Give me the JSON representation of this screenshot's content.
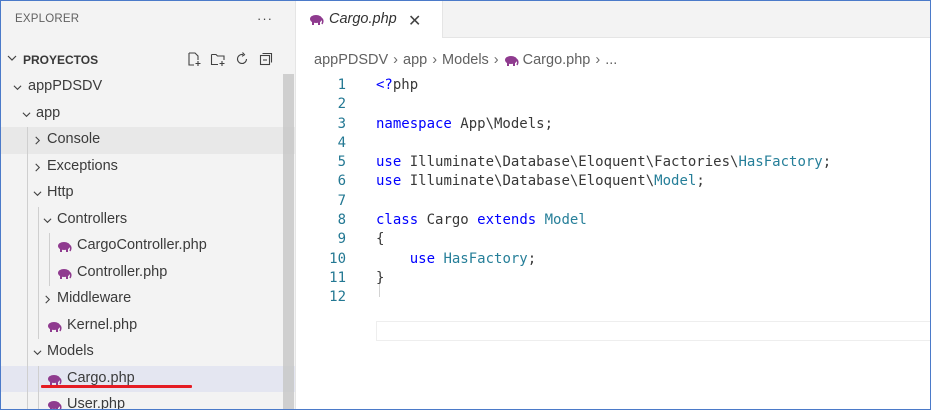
{
  "sidebar": {
    "header": "EXPLORER",
    "more": "···",
    "section": "PROYECTOS",
    "tools": [
      "new-file-icon",
      "new-folder-icon",
      "refresh-icon",
      "collapse-all-icon"
    ],
    "tree": [
      {
        "label": "appPDSDV",
        "type": "folder",
        "open": true,
        "depth": 0
      },
      {
        "label": "app",
        "type": "folder",
        "open": true,
        "depth": 1
      },
      {
        "label": "Console",
        "type": "folder",
        "open": false,
        "depth": 2
      },
      {
        "label": "Exceptions",
        "type": "folder",
        "open": false,
        "depth": 2
      },
      {
        "label": "Http",
        "type": "folder",
        "open": true,
        "depth": 2
      },
      {
        "label": "Controllers",
        "type": "folder",
        "open": true,
        "depth": 3
      },
      {
        "label": "CargoController.php",
        "type": "php",
        "depth": 4
      },
      {
        "label": "Controller.php",
        "type": "php",
        "depth": 4
      },
      {
        "label": "Middleware",
        "type": "folder",
        "open": false,
        "depth": 3
      },
      {
        "label": "Kernel.php",
        "type": "php",
        "depth": 3
      },
      {
        "label": "Models",
        "type": "folder",
        "open": true,
        "depth": 2
      },
      {
        "label": "Cargo.php",
        "type": "php",
        "depth": 3
      },
      {
        "label": "User.php",
        "type": "php",
        "depth": 3
      }
    ]
  },
  "editor": {
    "tab": {
      "name": "Cargo.php",
      "close": "✕"
    },
    "breadcrumb": [
      "appPDSDV",
      "app",
      "Models",
      "Cargo.php",
      "..."
    ],
    "lines": [
      {
        "n": "1",
        "text": "<?php"
      },
      {
        "n": "2",
        "text": ""
      },
      {
        "n": "3",
        "text": "namespace App\\Models;"
      },
      {
        "n": "4",
        "text": ""
      },
      {
        "n": "5",
        "text": "use Illuminate\\Database\\Eloquent\\Factories\\HasFactory;"
      },
      {
        "n": "6",
        "text": "use Illuminate\\Database\\Eloquent\\Model;"
      },
      {
        "n": "7",
        "text": ""
      },
      {
        "n": "8",
        "text": "class Cargo extends Model"
      },
      {
        "n": "9",
        "text": "{"
      },
      {
        "n": "10",
        "text": "    use HasFactory;"
      },
      {
        "n": "11",
        "text": "}"
      },
      {
        "n": "12",
        "text": ""
      }
    ]
  },
  "colors": {
    "keyword": "#0000ff",
    "class": "#267f99",
    "linenum": "#237893",
    "php_icon": "#8f3b8f"
  }
}
